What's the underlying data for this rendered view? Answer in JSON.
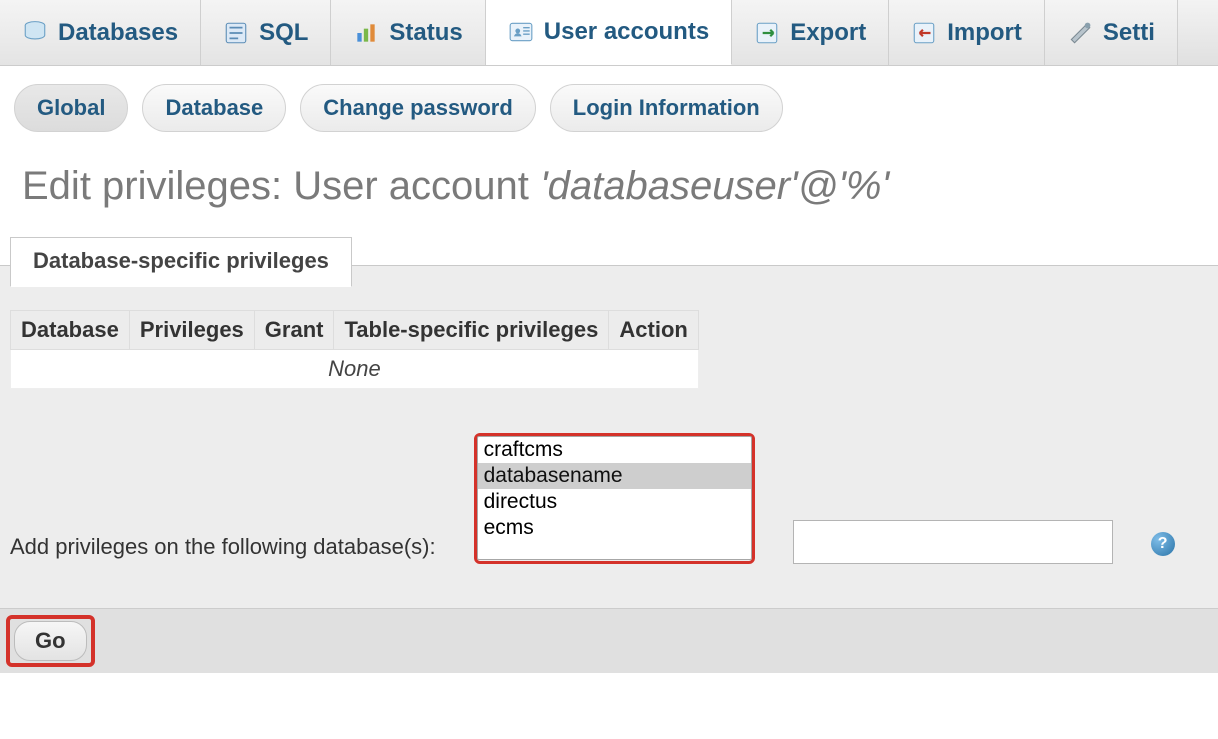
{
  "mainTabs": [
    {
      "id": "databases",
      "label": "Databases",
      "icon": "database-icon",
      "active": false
    },
    {
      "id": "sql",
      "label": "SQL",
      "icon": "sql-icon",
      "active": false
    },
    {
      "id": "status",
      "label": "Status",
      "icon": "status-icon",
      "active": false
    },
    {
      "id": "users",
      "label": "User accounts",
      "icon": "users-icon",
      "active": true
    },
    {
      "id": "export",
      "label": "Export",
      "icon": "export-icon",
      "active": false
    },
    {
      "id": "import",
      "label": "Import",
      "icon": "import-icon",
      "active": false
    },
    {
      "id": "settings",
      "label": "Setti",
      "icon": "settings-icon",
      "active": false
    }
  ],
  "subTabs": [
    {
      "id": "global",
      "label": "Global",
      "active": true
    },
    {
      "id": "database",
      "label": "Database",
      "active": false
    },
    {
      "id": "changepw",
      "label": "Change password",
      "active": false
    },
    {
      "id": "logininf",
      "label": "Login Information",
      "active": false
    }
  ],
  "heading": {
    "prefix": "Edit privileges: User account ",
    "italic": "'databaseuser'@'%'"
  },
  "panel": {
    "title": "Database-specific privileges",
    "table": {
      "columns": [
        "Database",
        "Privileges",
        "Grant",
        "Table-specific privileges",
        "Action"
      ],
      "emptyText": "None"
    },
    "addLabel": "Add privileges on the following database(s):",
    "dbOptions": [
      "craftcms",
      "databasename",
      "directus",
      "ecms"
    ],
    "dbSelected": "databasename",
    "goLabel": "Go"
  }
}
